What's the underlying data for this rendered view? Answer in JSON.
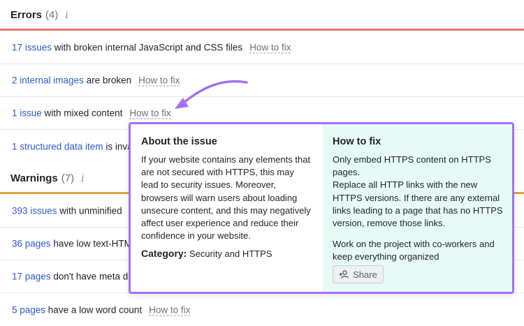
{
  "errors": {
    "title": "Errors",
    "count": "(4)",
    "info_glyph": "i",
    "rule_color": "#e8787a",
    "rows": [
      {
        "link": "17 issues",
        "text": " with broken internal JavaScript and CSS files",
        "howto": "How to fix"
      },
      {
        "link": "2 internal images",
        "text": " are broken",
        "howto": "How to fix"
      },
      {
        "link": "1 issue",
        "text": " with mixed content",
        "howto": "How to fix"
      },
      {
        "link": "1 structured data item",
        "text": " is inva",
        "howto": ""
      }
    ]
  },
  "warnings": {
    "title": "Warnings",
    "count": "(7)",
    "info_glyph": "i",
    "rule_color": "#e0a040",
    "rows": [
      {
        "link": "393 issues",
        "text": " with unminified",
        "howto": ""
      },
      {
        "link": "36 pages",
        "text": " have low text-HTM",
        "howto": ""
      },
      {
        "link": "17 pages",
        "text": " don't have meta d",
        "howto": ""
      },
      {
        "link": "5 pages",
        "text": " have a low word count",
        "howto": "How to fix"
      }
    ]
  },
  "popup": {
    "about_title": "About the issue",
    "about_text": "If your website contains any elements that are not secured with HTTPS, this may lead to security issues. Moreover, browsers will warn users about loading unsecure content, and this may negatively affect user experience and reduce their confidence in your website.",
    "category_label": "Category:",
    "category_value": " Security and HTTPS",
    "howto_title": "How to fix",
    "howto_p1": "Only embed HTTPS content on HTTPS pages.",
    "howto_p2": "Replace all HTTP links with the new HTTPS versions. If there are any external links leading to a page that has no HTTPS version, remove those links.",
    "collab_text": "Work on the project with co-workers and keep everything organized",
    "share_label": "Share",
    "border_color": "#a271f2"
  },
  "icons": {
    "info": "info-icon",
    "share": "add-user-icon",
    "arrow": "annotation-arrow-icon"
  }
}
